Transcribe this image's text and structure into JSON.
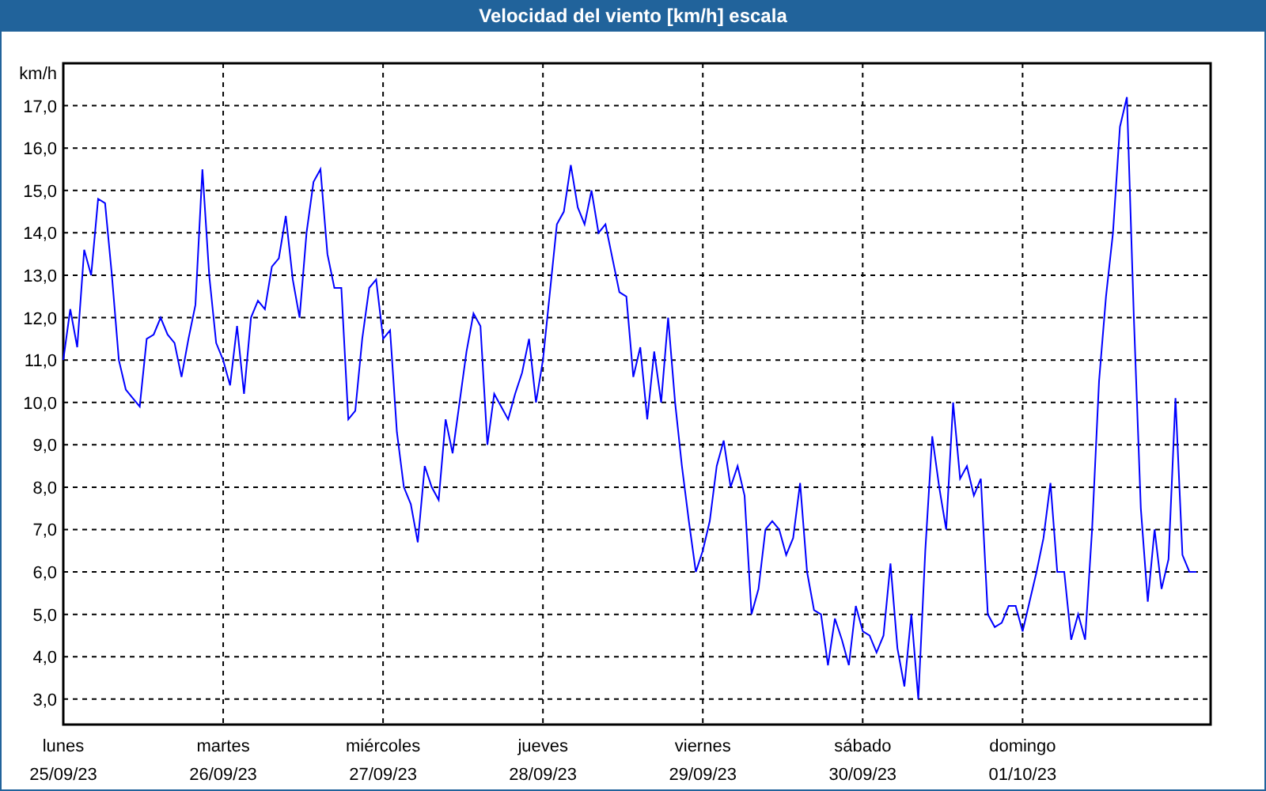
{
  "window": {
    "title": "Velocidad del viento [km/h] escala"
  },
  "chart": {
    "dates": [
      "25/09/23",
      "26/09/23",
      "27/09/23",
      "28/09/23",
      "29/09/23",
      "30/09/23",
      "01/10/23"
    ],
    "chart_data": {
      "type": "line",
      "grid": true,
      "ylabel": "km/h",
      "ylim": [
        2.4,
        18
      ],
      "yticks": [
        {
          "value": 3,
          "label": "3,0"
        },
        {
          "value": 4,
          "label": "4,0"
        },
        {
          "value": 5,
          "label": "5,0"
        },
        {
          "value": 6,
          "label": "6,0"
        },
        {
          "value": 7,
          "label": "7,0"
        },
        {
          "value": 8,
          "label": "8,0"
        },
        {
          "value": 9,
          "label": "9,0"
        },
        {
          "value": 10,
          "label": "10,0"
        },
        {
          "value": 11,
          "label": "11,0"
        },
        {
          "value": 12,
          "label": "12,0"
        },
        {
          "value": 13,
          "label": "13,0"
        },
        {
          "value": 14,
          "label": "14,0"
        },
        {
          "value": 15,
          "label": "15,0"
        },
        {
          "value": 16,
          "label": "16,0"
        },
        {
          "value": 17,
          "label": "17,0"
        }
      ],
      "categories": [
        "lunes",
        null,
        null,
        null,
        null,
        null,
        null,
        null,
        null,
        null,
        null,
        null,
        null,
        null,
        null,
        null,
        null,
        null,
        null,
        null,
        null,
        null,
        null,
        "martes",
        null,
        null,
        null,
        null,
        null,
        null,
        null,
        null,
        null,
        null,
        null,
        null,
        null,
        null,
        null,
        null,
        null,
        null,
        null,
        null,
        null,
        null,
        "miércoles",
        null,
        null,
        null,
        null,
        null,
        null,
        null,
        null,
        null,
        null,
        null,
        null,
        null,
        null,
        null,
        null,
        null,
        null,
        null,
        null,
        null,
        null,
        "jueves",
        null,
        null,
        null,
        null,
        null,
        null,
        null,
        null,
        null,
        null,
        null,
        null,
        null,
        null,
        null,
        null,
        null,
        null,
        null,
        null,
        null,
        null,
        "viernes",
        null,
        null,
        null,
        null,
        null,
        null,
        null,
        null,
        null,
        null,
        null,
        null,
        null,
        null,
        null,
        null,
        null,
        null,
        null,
        null,
        null,
        null,
        "sábado",
        null,
        null,
        null,
        null,
        null,
        null,
        null,
        null,
        null,
        null,
        null,
        null,
        null,
        null,
        null,
        null,
        null,
        null,
        null,
        null,
        null,
        null,
        "domingo",
        null,
        null,
        null,
        null,
        null,
        null,
        null,
        null,
        null,
        null,
        null,
        null,
        null,
        null,
        null,
        null,
        null,
        null,
        null,
        null,
        null,
        null,
        null,
        null,
        null
      ],
      "series": [
        {
          "color": "#0000ff",
          "values": [
            11.0,
            12.2,
            11.3,
            13.6,
            13.0,
            14.8,
            14.7,
            13.0,
            11.0,
            10.3,
            10.1,
            9.9,
            11.5,
            11.6,
            12.0,
            11.6,
            11.4,
            10.6,
            11.5,
            12.3,
            15.5,
            13.0,
            11.4,
            11.0,
            10.4,
            11.8,
            10.2,
            12.0,
            12.4,
            12.2,
            13.2,
            13.4,
            14.4,
            12.9,
            12.0,
            14.0,
            15.2,
            15.5,
            13.5,
            12.7,
            12.7,
            9.6,
            9.8,
            11.5,
            12.7,
            12.9,
            11.5,
            11.7,
            9.3,
            8.0,
            7.6,
            6.7,
            8.5,
            8.0,
            7.7,
            9.6,
            8.8,
            10.0,
            11.2,
            12.1,
            11.8,
            9.0,
            10.2,
            9.9,
            9.6,
            10.2,
            10.7,
            11.5,
            10.0,
            11.0,
            12.6,
            14.2,
            14.5,
            15.6,
            14.6,
            14.2,
            15.0,
            14.0,
            14.2,
            13.4,
            12.6,
            12.5,
            10.6,
            11.3,
            9.6,
            11.2,
            10.0,
            12.0,
            10.0,
            8.5,
            7.2,
            6.0,
            6.5,
            7.2,
            8.5,
            9.1,
            8.0,
            8.5,
            7.8,
            5.0,
            5.6,
            7.0,
            7.2,
            7.0,
            6.4,
            6.8,
            8.1,
            6.0,
            5.1,
            5.0,
            3.8,
            4.9,
            4.4,
            3.8,
            5.2,
            4.6,
            4.5,
            4.1,
            4.5,
            6.2,
            4.2,
            3.3,
            5.0,
            3.0,
            6.5,
            9.2,
            8.0,
            7.0,
            10.0,
            8.2,
            8.5,
            7.8,
            8.2,
            5.0,
            4.7,
            4.8,
            5.2,
            5.2,
            4.6,
            5.3,
            6.0,
            6.8,
            8.1,
            6.0,
            6.0,
            4.4,
            5.0,
            4.4,
            7.0,
            10.5,
            12.5,
            14.0,
            16.5,
            17.2,
            12.0,
            7.5,
            5.3,
            7.0,
            5.6,
            6.3,
            10.1,
            6.4,
            6.0,
            6.0
          ]
        }
      ]
    }
  }
}
